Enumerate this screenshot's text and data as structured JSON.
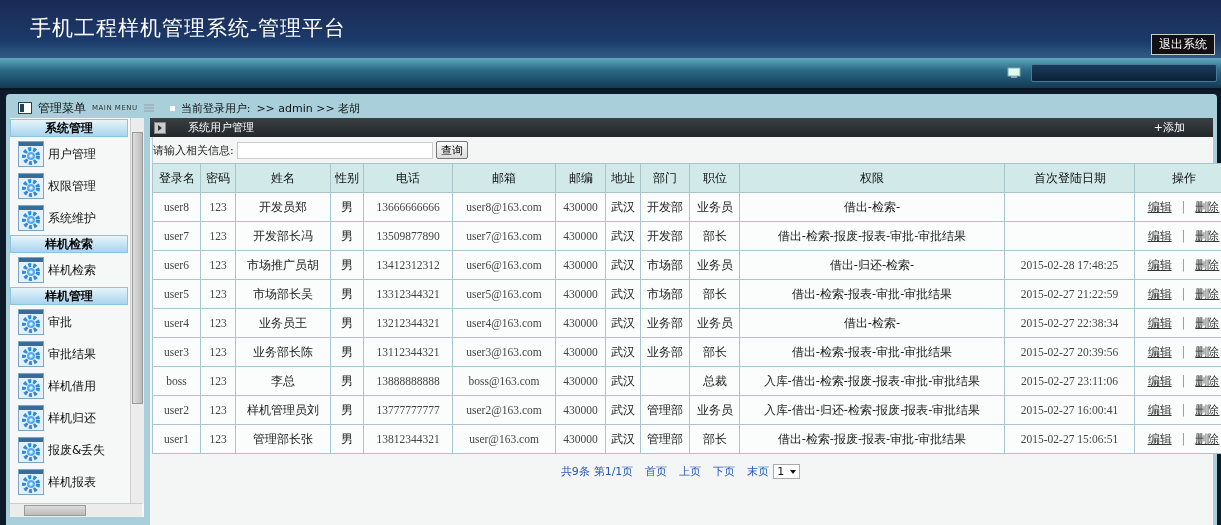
{
  "header": {
    "title": "手机工程样机管理系统-管理平台",
    "logout_button": "退出系统"
  },
  "menu_bar": {
    "title": "管理菜单",
    "subtitle": "MAIN MENU",
    "user_label": "当前登录用户:",
    "user_path": ">> admin >> 老胡"
  },
  "sidebar": {
    "items": [
      {
        "kind": "section",
        "label": "系统管理"
      },
      {
        "kind": "item",
        "label": "用户管理"
      },
      {
        "kind": "item",
        "label": "权限管理"
      },
      {
        "kind": "item",
        "label": "系统维护"
      },
      {
        "kind": "section",
        "label": "样机检索"
      },
      {
        "kind": "item",
        "label": "样机检索"
      },
      {
        "kind": "section",
        "label": "样机管理"
      },
      {
        "kind": "item",
        "label": "审批"
      },
      {
        "kind": "item",
        "label": "审批结果"
      },
      {
        "kind": "item",
        "label": "样机借用"
      },
      {
        "kind": "item",
        "label": "样机归还"
      },
      {
        "kind": "item",
        "label": "报废&丢失"
      },
      {
        "kind": "item",
        "label": "样机报表"
      }
    ]
  },
  "panel": {
    "title": "系统用户管理",
    "add_button": "+添加"
  },
  "search": {
    "label": "请输入相关信息:",
    "button": "查询"
  },
  "table": {
    "columns": [
      "登录名",
      "密码",
      "姓名",
      "性别",
      "电话",
      "邮箱",
      "邮编",
      "地址",
      "部门",
      "职位",
      "权限",
      "首次登陆日期",
      "操作"
    ],
    "rows": [
      {
        "cells": [
          "user8",
          "123",
          "开发员郑",
          "男",
          "13666666666",
          "user8@163.com",
          "430000",
          "武汉",
          "开发部",
          "业务员",
          "借出-检索-",
          ""
        ]
      },
      {
        "cells": [
          "user7",
          "123",
          "开发部长冯",
          "男",
          "13509877890",
          "user7@163.com",
          "430000",
          "武汉",
          "开发部",
          "部长",
          "借出-检索-报废-报表-审批-审批结果",
          ""
        ]
      },
      {
        "cells": [
          "user6",
          "123",
          "市场推广员胡",
          "男",
          "13412312312",
          "user6@163.com",
          "430000",
          "武汉",
          "市场部",
          "业务员",
          "借出-归还-检索-",
          "2015-02-28 17:48:25"
        ]
      },
      {
        "cells": [
          "user5",
          "123",
          "市场部长吴",
          "男",
          "13312344321",
          "user5@163.com",
          "430000",
          "武汉",
          "市场部",
          "部长",
          "借出-检索-报表-审批-审批结果",
          "2015-02-27 21:22:59"
        ]
      },
      {
        "cells": [
          "user4",
          "123",
          "业务员王",
          "男",
          "13212344321",
          "user4@163.com",
          "430000",
          "武汉",
          "业务部",
          "业务员",
          "借出-检索-",
          "2015-02-27 22:38:34"
        ]
      },
      {
        "cells": [
          "user3",
          "123",
          "业务部长陈",
          "男",
          "13112344321",
          "user3@163.com",
          "430000",
          "武汉",
          "业务部",
          "部长",
          "借出-检索-报表-审批-审批结果",
          "2015-02-27 20:39:56"
        ]
      },
      {
        "cells": [
          "boss",
          "123",
          "李总",
          "男",
          "13888888888",
          "boss@163.com",
          "430000",
          "武汉",
          "",
          "总裁",
          "入库-借出-检索-报废-报表-审批-审批结果",
          "2015-02-27 23:11:06"
        ]
      },
      {
        "cells": [
          "user2",
          "123",
          "样机管理员刘",
          "男",
          "13777777777",
          "user2@163.com",
          "430000",
          "武汉",
          "管理部",
          "业务员",
          "入库-借出-归还-检索-报废-报表-审批结果",
          "2015-02-27 16:00:41"
        ]
      },
      {
        "cells": [
          "user1",
          "123",
          "管理部长张",
          "男",
          "13812344321",
          "user@163.com",
          "430000",
          "武汉",
          "管理部",
          "部长",
          "借出-检索-报废-报表-审批-审批结果",
          "2015-02-27 15:06:51"
        ]
      }
    ],
    "actions": [
      {
        "edit": "编辑",
        "separator": "|",
        "delete": "删除"
      },
      {
        "edit": "编辑",
        "separator": "|",
        "delete": "删除"
      },
      {
        "edit": "编辑",
        "separator": "|",
        "delete": "删除"
      },
      {
        "edit": "编辑",
        "separator": "|",
        "delete": "删除"
      },
      {
        "edit": "编辑",
        "separator": "|",
        "delete": "删除"
      },
      {
        "edit": "编辑",
        "separator": "|",
        "delete": "删除"
      },
      {
        "edit": "编辑",
        "separator": "|",
        "delete": "删除"
      },
      {
        "edit": "编辑",
        "separator": "|",
        "delete": "删除"
      },
      {
        "edit": "编辑",
        "separator": "|",
        "delete": "删除"
      }
    ]
  },
  "pagination": {
    "total": "共9条",
    "page": "第1/1页",
    "links": [
      "首页",
      "上页",
      "下页",
      "末页"
    ],
    "page_select": "1"
  }
}
